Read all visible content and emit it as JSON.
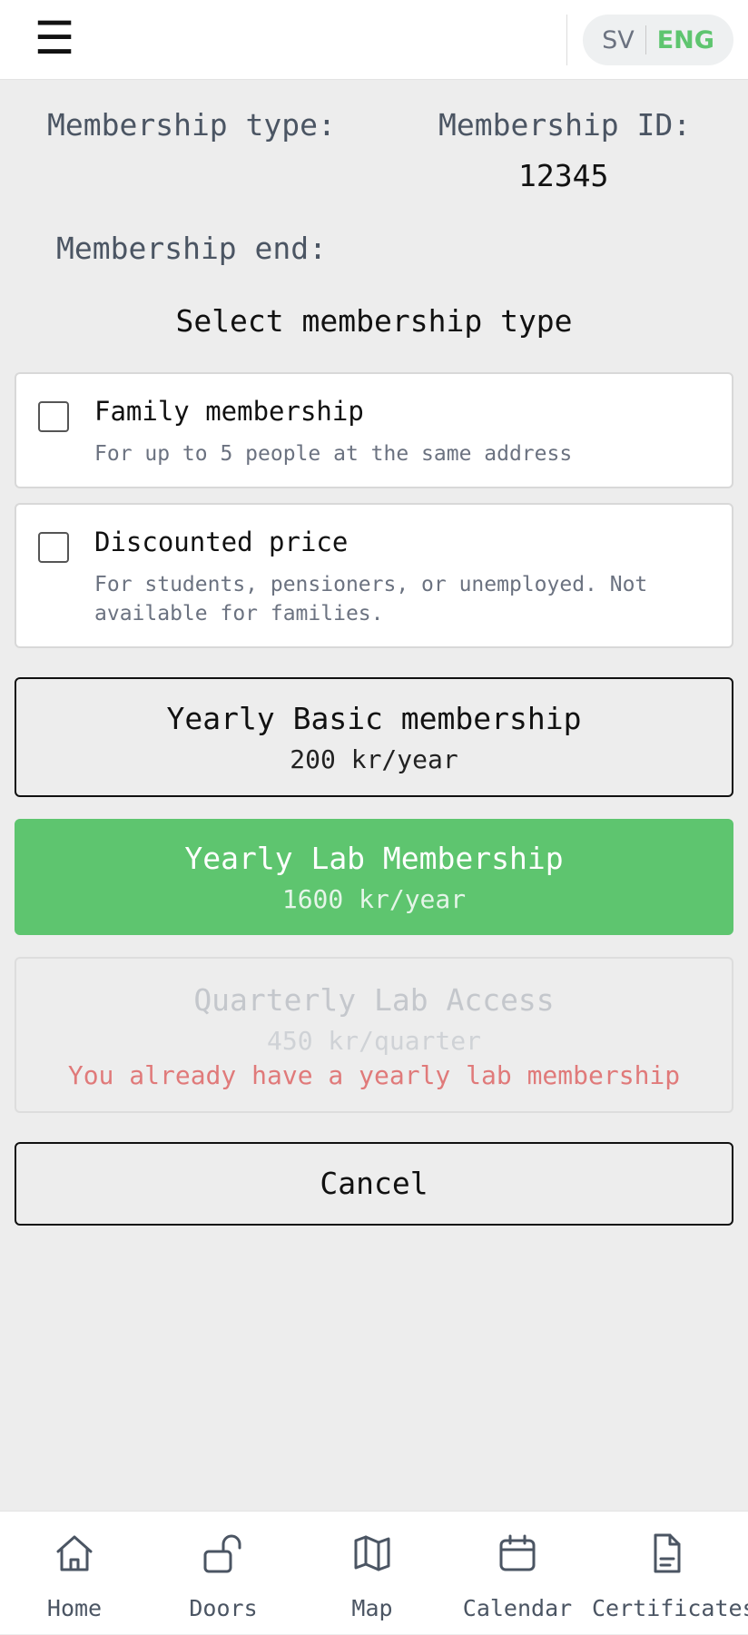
{
  "header": {
    "menu_icon": "hamburger-menu-icon",
    "menu_glyph": "☰",
    "languages": {
      "sv": "SV",
      "eng": "ENG",
      "active": "ENG"
    },
    "active_color": "#5ec56f"
  },
  "info": {
    "membership_type_label": "Membership type:",
    "membership_id_label": "Membership ID:",
    "membership_id_value": "12345",
    "membership_end_label": "Membership end:"
  },
  "select_title": "Select membership type",
  "options": [
    {
      "title": "Family membership",
      "description": "For up to 5 people at the same address",
      "checked": false
    },
    {
      "title": "Discounted price",
      "description": "For students, pensioners, or unemployed. Not available for families.",
      "checked": false
    }
  ],
  "plans": [
    {
      "name": "Yearly Basic membership",
      "price": "200 kr/year",
      "state": "available"
    },
    {
      "name": "Yearly Lab Membership",
      "price": "1600 kr/year",
      "state": "selected"
    },
    {
      "name": "Quarterly Lab Access",
      "price": "450 kr/quarter",
      "state": "disabled",
      "warning": "You already have a yearly lab membership"
    }
  ],
  "cancel_label": "Cancel",
  "nav": [
    {
      "label": "Home",
      "icon": "home-icon"
    },
    {
      "label": "Doors",
      "icon": "unlock-icon"
    },
    {
      "label": "Map",
      "icon": "map-icon"
    },
    {
      "label": "Calendar",
      "icon": "calendar-icon"
    },
    {
      "label": "Certificates",
      "icon": "document-icon"
    }
  ],
  "colors": {
    "accent": "#5ec56f",
    "warning": "#e07a7a",
    "background": "#ededed"
  }
}
